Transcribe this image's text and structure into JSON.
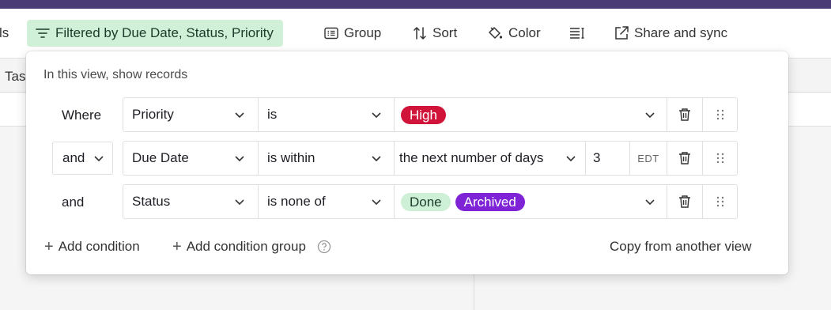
{
  "toolbar": {
    "partial_left": "ls",
    "filter_label": "Filtered by Due Date, Status, Priority",
    "group_label": "Group",
    "sort_label": "Sort",
    "color_label": "Color",
    "share_label": "Share and sync"
  },
  "grid": {
    "partial_header": "Tas"
  },
  "filter_popover": {
    "heading": "In this view, show records",
    "conditions": [
      {
        "conjunction": "Where",
        "field": "Priority",
        "operator": "is",
        "values": [
          "High"
        ]
      },
      {
        "conjunction": "and",
        "field": "Due Date",
        "operator": "is within",
        "value_mode": "the next number of days",
        "number": "3",
        "timezone": "EDT"
      },
      {
        "conjunction": "and",
        "field": "Status",
        "operator": "is none of",
        "values": [
          "Done",
          "Archived"
        ]
      }
    ],
    "add_condition": "Add condition",
    "add_condition_group": "Add condition group",
    "copy_from": "Copy from another view"
  },
  "colors": {
    "filter_bg": "#d0f0d7",
    "high": "#d1143a",
    "done": "#cdf0d6",
    "archived": "#7e24d6",
    "top_bar": "#4a3a75"
  },
  "icons": [
    "filter-icon",
    "group-icon",
    "sort-icon",
    "color-icon",
    "row-height-icon",
    "share-icon",
    "chevron-down-icon",
    "trash-icon",
    "drag-handle-icon",
    "help-icon"
  ]
}
